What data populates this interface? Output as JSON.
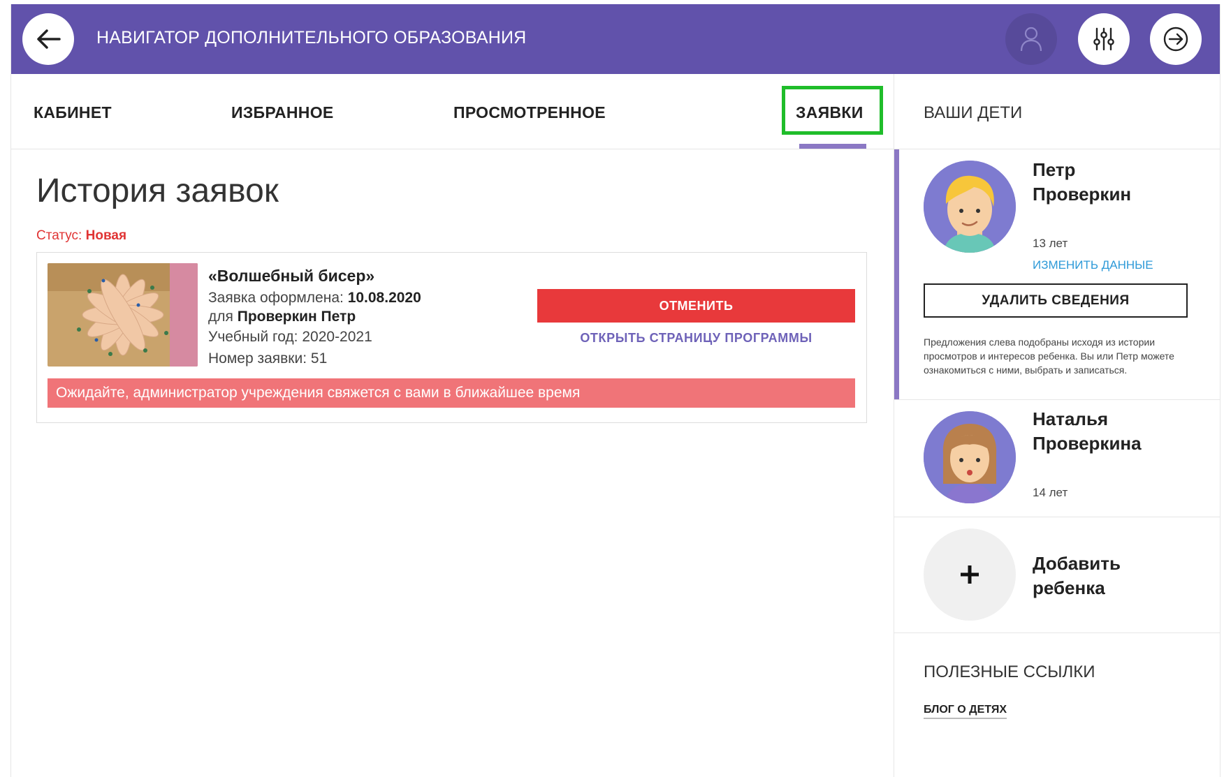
{
  "header": {
    "title": "НАВИГАТОР ДОПОЛНИТЕЛЬНОГО ОБРАЗОВАНИЯ",
    "back_icon": "arrow-left-icon",
    "profile_icon": "user-icon",
    "filter_icon": "sliders-icon",
    "logout_icon": "arrow-right-circle-icon"
  },
  "tabs": [
    {
      "label": "КАБИНЕТ"
    },
    {
      "label": "ИЗБРАННОЕ"
    },
    {
      "label": "ПРОСМОТРЕННОЕ"
    },
    {
      "label": "ЗАЯВКИ",
      "active": true
    }
  ],
  "main": {
    "title": "История заявок",
    "status_label": "Статус: ",
    "status_value": "Новая",
    "application": {
      "program_title": "«Волшебный бисер»",
      "submitted_label": "Заявка оформлена: ",
      "submitted_date": "10.08.2020",
      "for_label": "для ",
      "for_name": "Проверкин Петр",
      "school_year": "Учебный год: 2020-2021",
      "number": "Номер заявки: 51",
      "cancel_label": "ОТМЕНИТЬ",
      "open_label": "ОТКРЫТЬ СТРАНИЦУ ПРОГРАММЫ",
      "wait_message": "Ожидайте, администратор учреждения свяжется с вами в ближайшее время"
    }
  },
  "sidebar": {
    "heading": "ВАШИ ДЕТИ",
    "children": [
      {
        "first_name": "Петр",
        "last_name": "Проверкин",
        "age": "13 лет",
        "edit_label": "ИЗМЕНИТЬ ДАННЫЕ",
        "delete_label": "УДАЛИТЬ СВЕДЕНИЯ",
        "hint": "Предложения слева подобраны исходя из истории просмотров и интересов ребенка. Вы или Петр можете ознакомиться с ними, выбрать и записаться."
      },
      {
        "first_name": "Наталья",
        "last_name": "Проверкина",
        "age": "14 лет"
      }
    ],
    "add_child": {
      "line1": "Добавить",
      "line2": "ребенка",
      "icon": "plus-icon"
    },
    "links_heading": "ПОЛЕЗНЫЕ ССЫЛКИ",
    "links": [
      {
        "label": "БЛОГ О ДЕТЯХ"
      }
    ]
  },
  "colors": {
    "brand_purple": "#6152ab",
    "accent_red": "#e8393b",
    "highlight_green": "#1fbd2a",
    "link_blue": "#2e9ad8"
  }
}
